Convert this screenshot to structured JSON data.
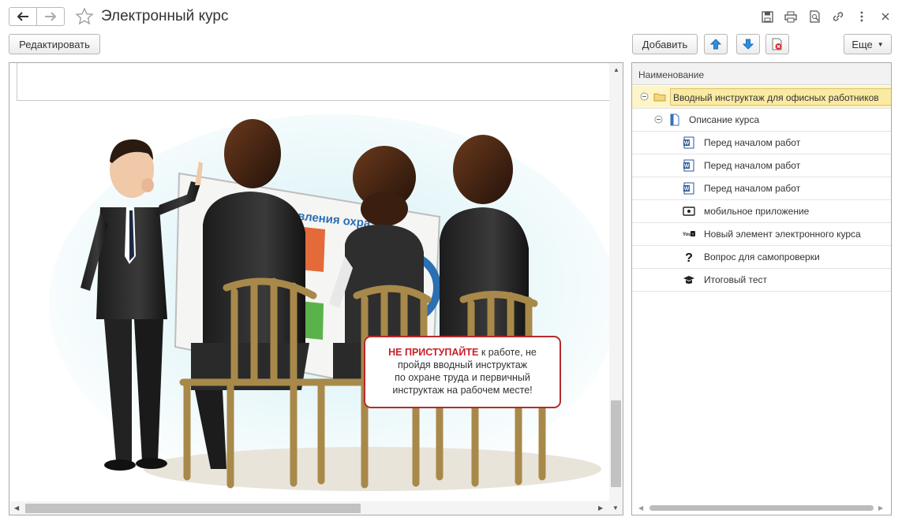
{
  "window": {
    "title": "Электронный курс"
  },
  "toolbar": {
    "edit_label": "Редактировать",
    "add_label": "Добавить",
    "more_label": "Еще"
  },
  "icons": {
    "back": "arrow-left-icon",
    "forward": "arrow-right-icon",
    "favorite": "star-icon",
    "save": "floppy-icon",
    "print": "printer-icon",
    "preview": "preview-icon",
    "link": "link-icon",
    "menu": "more-vertical-icon",
    "close": "close-icon",
    "move_up": "arrow-up-icon",
    "move_down": "arrow-down-icon",
    "delete": "delete-doc-icon"
  },
  "colors": {
    "accent_blue": "#2f8fe0",
    "selection": "#fbeaa2",
    "warning_red": "#c8202a"
  },
  "illustration": {
    "board_heading": "управления охра",
    "notice_emphasis": "НЕ ПРИСТУПАЙТЕ",
    "notice_line1_rest": " к работе, не",
    "notice_line2": "пройдя вводный инструктаж",
    "notice_line3": "по охране труда и первичный",
    "notice_line4": "инструктаж на рабочем месте!"
  },
  "tree": {
    "column_header": "Наименование",
    "items": [
      {
        "label": "Вводный инструктаж для офисных работников",
        "icon": "folder-icon",
        "level": 0,
        "expanded": true,
        "selected": true
      },
      {
        "label": "Описание курса",
        "icon": "document-icon",
        "level": 1,
        "expanded": true,
        "selected": false
      },
      {
        "label": "Перед началом работ",
        "icon": "word-doc-icon",
        "level": 2,
        "selected": false
      },
      {
        "label": "Перед началом работ",
        "icon": "word-doc-icon",
        "level": 2,
        "selected": false
      },
      {
        "label": "Перед началом работ",
        "icon": "word-doc-icon",
        "level": 2,
        "selected": false
      },
      {
        "label": "мобильное приложение",
        "icon": "mobile-app-icon",
        "level": 2,
        "selected": false
      },
      {
        "label": "Новый элемент электронного курса",
        "icon": "youtube-icon",
        "level": 2,
        "selected": false
      },
      {
        "label": "Вопрос для самопроверки",
        "icon": "question-icon",
        "level": 2,
        "selected": false
      },
      {
        "label": "Итоговый тест",
        "icon": "graduation-cap-icon",
        "level": 2,
        "selected": false
      }
    ]
  }
}
